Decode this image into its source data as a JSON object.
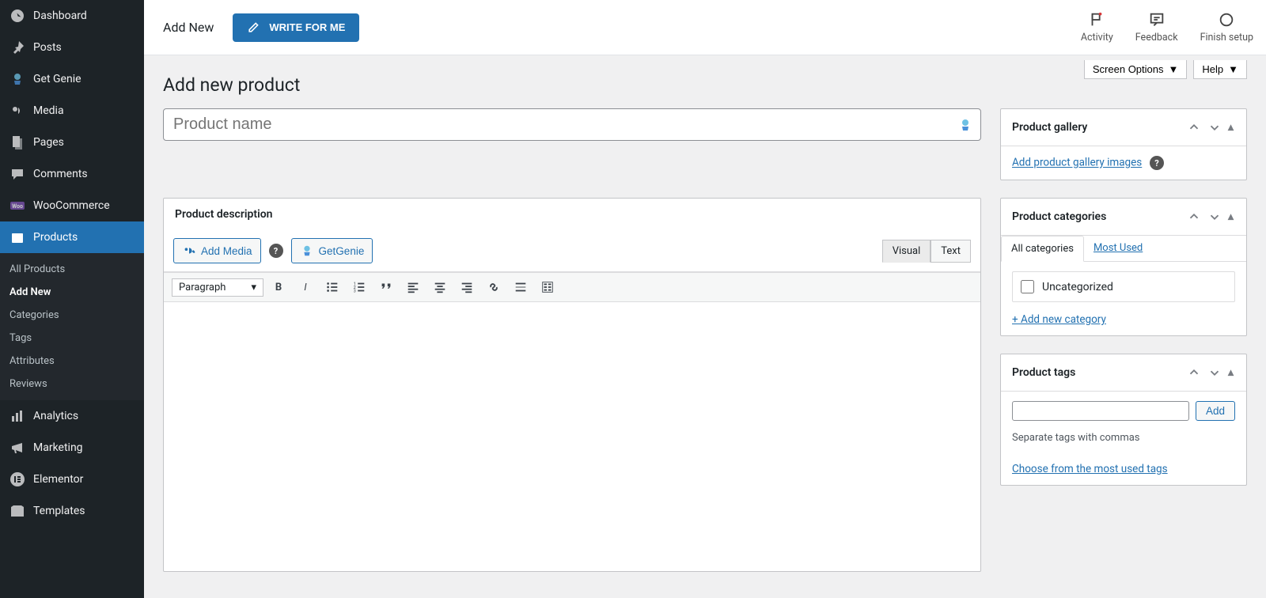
{
  "sidebar": {
    "items": [
      {
        "label": "Dashboard",
        "icon": "dashboard"
      },
      {
        "label": "Posts",
        "icon": "pin"
      },
      {
        "label": "Get Genie",
        "icon": "genie"
      },
      {
        "label": "Media",
        "icon": "media"
      },
      {
        "label": "Pages",
        "icon": "pages"
      },
      {
        "label": "Comments",
        "icon": "comments"
      },
      {
        "label": "WooCommerce",
        "icon": "woo"
      },
      {
        "label": "Products",
        "icon": "products"
      },
      {
        "label": "Analytics",
        "icon": "analytics"
      },
      {
        "label": "Marketing",
        "icon": "marketing"
      },
      {
        "label": "Elementor",
        "icon": "elementor"
      },
      {
        "label": "Templates",
        "icon": "templates"
      }
    ],
    "submenu": [
      {
        "label": "All Products"
      },
      {
        "label": "Add New",
        "current": true
      },
      {
        "label": "Categories"
      },
      {
        "label": "Tags"
      },
      {
        "label": "Attributes"
      },
      {
        "label": "Reviews"
      }
    ]
  },
  "topbar": {
    "title": "Add New",
    "write_btn": "WRITE FOR ME",
    "actions": [
      {
        "label": "Activity"
      },
      {
        "label": "Feedback"
      },
      {
        "label": "Finish setup"
      }
    ]
  },
  "screen": {
    "options": "Screen Options",
    "help": "Help"
  },
  "page": {
    "title": "Add new product",
    "product_name_placeholder": "Product name"
  },
  "editor": {
    "header": "Product description",
    "add_media": "Add Media",
    "getgenie": "GetGenie",
    "tab_visual": "Visual",
    "tab_text": "Text",
    "format_label": "Paragraph"
  },
  "panels": {
    "gallery": {
      "title": "Product gallery",
      "link": "Add product gallery images"
    },
    "categories": {
      "title": "Product categories",
      "tab_all": "All categories",
      "tab_most": "Most Used",
      "item": "Uncategorized",
      "add_new": "+ Add new category"
    },
    "tags": {
      "title": "Product tags",
      "add": "Add",
      "hint": "Separate tags with commas",
      "choose": "Choose from the most used tags"
    }
  }
}
